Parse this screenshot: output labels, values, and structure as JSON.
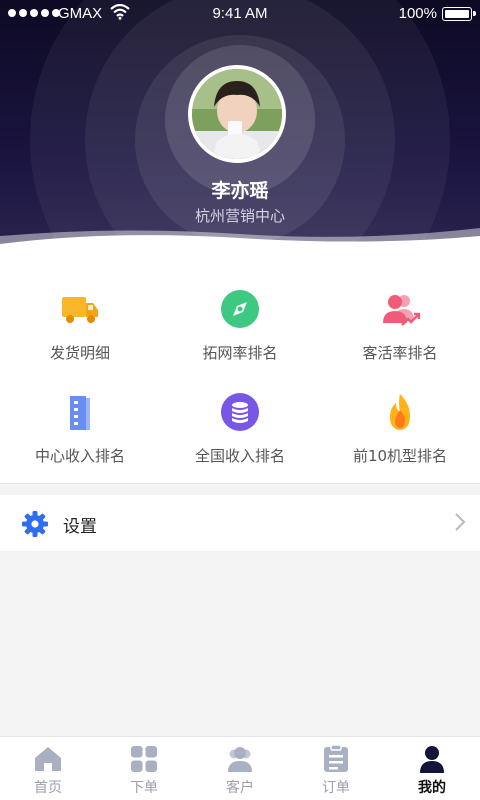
{
  "status_bar": {
    "carrier": "GMAX",
    "time": "9:41 AM",
    "battery": "100%"
  },
  "profile": {
    "name": "李亦瑶",
    "department": "杭州营销中心"
  },
  "grid": {
    "items": [
      {
        "label": "发货明细",
        "icon": "truck-icon"
      },
      {
        "label": "拓网率排名",
        "icon": "compass-icon"
      },
      {
        "label": "客活率排名",
        "icon": "users-trend-icon"
      },
      {
        "label": "中心收入排名",
        "icon": "building-icon"
      },
      {
        "label": "全国收入排名",
        "icon": "coin-stack-icon"
      },
      {
        "label": "前10机型排名",
        "icon": "flame-icon"
      }
    ]
  },
  "settings": {
    "label": "设置",
    "icon": "gear-icon"
  },
  "tabbar": {
    "tabs": [
      {
        "label": "首页",
        "icon": "home-icon"
      },
      {
        "label": "下单",
        "icon": "grid-icon"
      },
      {
        "label": "客户",
        "icon": "customers-icon"
      },
      {
        "label": "订单",
        "icon": "orders-icon"
      },
      {
        "label": "我的",
        "icon": "person-icon"
      }
    ],
    "active_index": 4
  },
  "colors": {
    "header_dark": "#0d0a24",
    "truck": "#f8b62a",
    "compass": "#3ec983",
    "users": "#f05c78",
    "building": "#6a8df2",
    "coins": "#7a56e6",
    "flame": "#ff9f1c",
    "gear": "#2d6ef0",
    "tab_inactive": "#9aa0b0",
    "tab_active": "#14143a"
  }
}
